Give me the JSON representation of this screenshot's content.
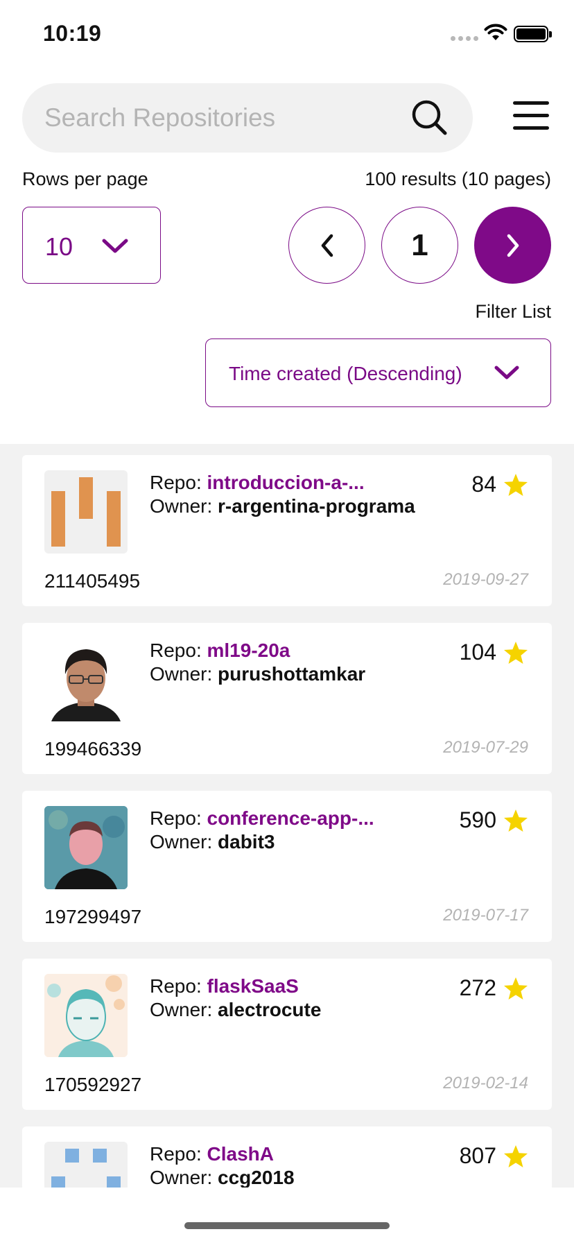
{
  "status_bar": {
    "time": "10:19"
  },
  "search": {
    "placeholder": "Search Repositories",
    "value": ""
  },
  "pagination": {
    "rows_label": "Rows per page",
    "rows_value": "10",
    "results_text": "100 results (10 pages)",
    "current_page": "1"
  },
  "filter": {
    "label": "Filter List",
    "sort_value": "Time created (Descending)"
  },
  "colors": {
    "accent": "#7f0a88",
    "star": "#f5d300",
    "list_bg": "#f2f2f2"
  },
  "repos": [
    {
      "repo_label": "Repo: ",
      "repo": "introduccion-a-...",
      "owner_label": "Owner: ",
      "owner": "r-argentina-programa",
      "stars": "84",
      "id": "211405495",
      "date": "2019-09-27",
      "avatar": "identicon-bars-orange"
    },
    {
      "repo_label": "Repo: ",
      "repo": "ml19-20a",
      "owner_label": "Owner: ",
      "owner": "purushottamkar",
      "stars": "104",
      "id": "199466339",
      "date": "2019-07-29",
      "avatar": "person-photo"
    },
    {
      "repo_label": "Repo: ",
      "repo": "conference-app-...",
      "owner_label": "Owner: ",
      "owner": "dabit3",
      "stars": "590",
      "id": "197299497",
      "date": "2019-07-17",
      "avatar": "person-photo-blue"
    },
    {
      "repo_label": "Repo: ",
      "repo": "flaskSaaS",
      "owner_label": "Owner: ",
      "owner": "alectrocute",
      "stars": "272",
      "id": "170592927",
      "date": "2019-02-14",
      "avatar": "person-sketch"
    },
    {
      "repo_label": "Repo: ",
      "repo": "ClashA",
      "owner_label": "Owner: ",
      "owner": "ccg2018",
      "stars": "807",
      "id": "",
      "date": "",
      "avatar": "identicon-squares-blue"
    }
  ]
}
